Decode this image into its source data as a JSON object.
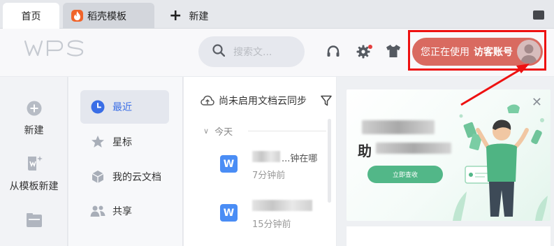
{
  "tabs": {
    "home": "首页",
    "template": "稻壳模板",
    "new": "新建"
  },
  "header": {
    "search_placeholder": "搜索文...",
    "visitor_prefix": "您正在使用",
    "visitor_account": "访客账号"
  },
  "rail": {
    "new": "新建",
    "from_template": "从模板新建"
  },
  "nav": {
    "recent": "最近",
    "starred": "星标",
    "cloud_docs": "我的云文档",
    "shared": "共享"
  },
  "files": {
    "sync_notice": "尚未启用文档云同步",
    "today": "今天",
    "items": [
      {
        "name_fragment": "...钟在哪",
        "time": "7分钟前"
      },
      {
        "time": "15分钟前"
      }
    ]
  },
  "banner": {
    "heading_fragment": "助",
    "cta_label": "立即查收"
  },
  "colors": {
    "accent_blue": "#3a6ee6",
    "visitor_pill": "#d96a60",
    "highlight_red": "#ee1111",
    "word_icon": "#4a8df5",
    "cta_green": "#52b788"
  }
}
